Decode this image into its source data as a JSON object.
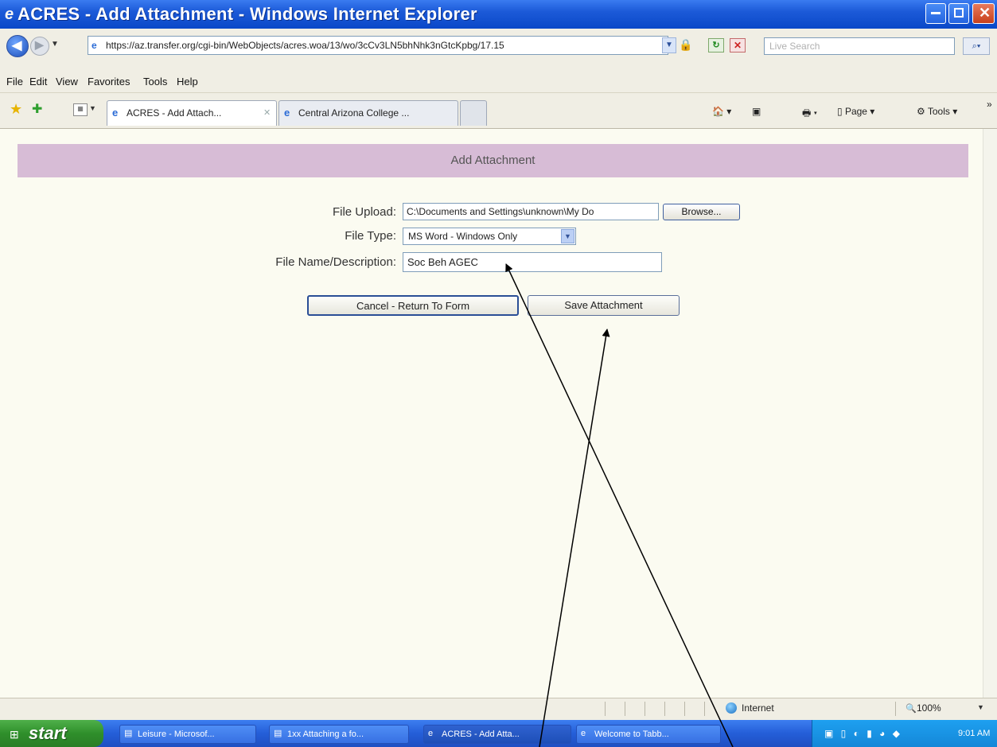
{
  "window": {
    "title": "ACRES - Add Attachment - Windows Internet Explorer"
  },
  "address_bar": {
    "url": "https://az.transfer.org/cgi-bin/WebObjects/acres.woa/13/wo/3cCv3LN5bhNhk3nGtcKpbg/17.15",
    "search_placeholder": "Live Search"
  },
  "menu": [
    "File",
    "Edit",
    "View",
    "Favorites",
    "Tools",
    "Help"
  ],
  "tabs": [
    {
      "label": "ACRES - Add Attach..."
    },
    {
      "label": "Central Arizona College ..."
    }
  ],
  "commands": {
    "page": "Page",
    "tools": "Tools"
  },
  "page": {
    "banner_title": "Add Attachment",
    "file_upload_label": "File Upload:",
    "file_upload_value": "C:\\Documents and Settings\\unknown\\My Do",
    "browse_label": "Browse...",
    "file_type_label": "File Type:",
    "file_type_value": "MS Word - Windows Only",
    "file_name_label": "File Name/Description:",
    "file_name_value": "Soc Beh AGEC",
    "cancel_label": "Cancel - Return To Form",
    "save_label": "Save Attachment"
  },
  "status_bar": {
    "zone": "Internet",
    "zoom": "100%"
  },
  "taskbar": {
    "start_label": "start",
    "tasks": [
      {
        "label": "Leisure - Microsof..."
      },
      {
        "label": "1xx Attaching a fo..."
      },
      {
        "label": "ACRES - Add Atta..."
      },
      {
        "label": "Welcome to Tabb..."
      }
    ],
    "clock": "9:01 AM"
  }
}
